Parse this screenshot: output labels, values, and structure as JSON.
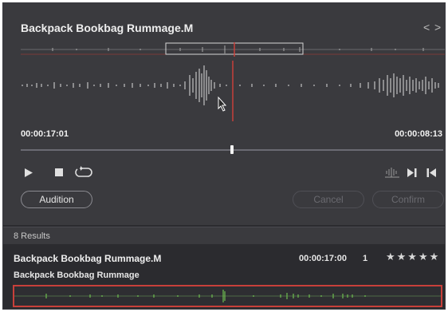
{
  "preview": {
    "title": "Backpack Bookbag Rummage.M",
    "nav_prev": "<",
    "nav_next": ">",
    "time_current": "00:00:17:01",
    "time_remaining": "00:00:08:13",
    "scrub_position": 0.5,
    "icons": {
      "play": "play-icon",
      "stop": "stop-icon",
      "loop": "loop-icon",
      "waveform_zoom": "waveform-zoom-icon",
      "mark_in": "mark-in-icon",
      "mark_out": "mark-out-icon"
    },
    "audition_label": "Audition",
    "cancel_label": "Cancel",
    "confirm_label": "Confirm"
  },
  "results": {
    "count_label": "8 Results",
    "items": [
      {
        "name": "Backpack Bookbag Rummage.M",
        "duration": "00:00:17:00",
        "channels": "1",
        "stars": "★★★★★",
        "description": "Backpack Bookbag Rummage"
      }
    ]
  },
  "colors": {
    "background": "#2b2b2f",
    "preview_panel": "#3a3a3e",
    "playhead": "#c8403a",
    "selection_border": "#c8403a",
    "waveform": "#bdbdbd",
    "clip_waveform": "#6dbf4f"
  }
}
